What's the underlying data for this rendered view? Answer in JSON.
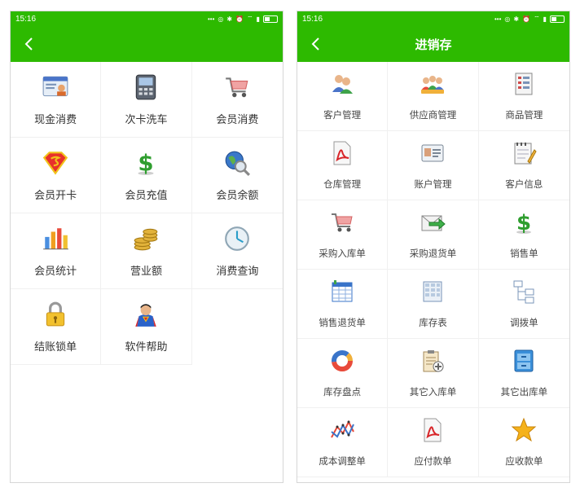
{
  "left": {
    "status": {
      "time": "15:16",
      "icons": [
        "dots-icon",
        "signal-icon",
        "bluetooth-icon",
        "alarm-icon",
        "wifi-icon",
        "cell-signal-icon",
        "battery-icon"
      ]
    },
    "title": "",
    "items": [
      {
        "label": "现金消费",
        "icon": "cash-register-icon"
      },
      {
        "label": "次卡洗车",
        "icon": "card-terminal-icon"
      },
      {
        "label": "会员消费",
        "icon": "shopping-cart-icon"
      },
      {
        "label": "会员开卡",
        "icon": "superman-shield-icon"
      },
      {
        "label": "会员充值",
        "icon": "dollar-icon"
      },
      {
        "label": "会员余额",
        "icon": "globe-search-icon"
      },
      {
        "label": "会员统计",
        "icon": "bar-chart-icon"
      },
      {
        "label": "营业额",
        "icon": "coins-icon"
      },
      {
        "label": "消费查询",
        "icon": "clock-icon"
      },
      {
        "label": "结账锁单",
        "icon": "lock-icon"
      },
      {
        "label": "软件帮助",
        "icon": "superman-icon"
      }
    ]
  },
  "right": {
    "status": {
      "time": "15:16",
      "icons": [
        "dots-icon",
        "signal-icon",
        "bluetooth-icon",
        "alarm-icon",
        "wifi-icon",
        "cell-signal-icon",
        "battery-icon"
      ]
    },
    "title": "进销存",
    "items": [
      {
        "label": "客户管理",
        "icon": "customers-icon"
      },
      {
        "label": "供应商管理",
        "icon": "suppliers-icon"
      },
      {
        "label": "商品管理",
        "icon": "product-list-icon"
      },
      {
        "label": "仓库管理",
        "icon": "pdf-document-icon"
      },
      {
        "label": "账户管理",
        "icon": "id-card-icon"
      },
      {
        "label": "客户信息",
        "icon": "notebook-pen-icon"
      },
      {
        "label": "采购入库单",
        "icon": "shopping-cart-icon"
      },
      {
        "label": "采购退货单",
        "icon": "envelope-arrow-icon"
      },
      {
        "label": "销售单",
        "icon": "dollar-icon"
      },
      {
        "label": "销售退货单",
        "icon": "spreadsheet-icon"
      },
      {
        "label": "库存表",
        "icon": "table-icon"
      },
      {
        "label": "调拨单",
        "icon": "tree-diagram-icon"
      },
      {
        "label": "库存盘点",
        "icon": "donut-chart-icon"
      },
      {
        "label": "其它入库单",
        "icon": "clipboard-add-icon"
      },
      {
        "label": "其它出库单",
        "icon": "cabinet-icon"
      },
      {
        "label": "成本调整单",
        "icon": "line-chart-icon"
      },
      {
        "label": "应付款单",
        "icon": "pdf-document-icon"
      },
      {
        "label": "应收款单",
        "icon": "star-icon"
      }
    ]
  },
  "colors": {
    "brand": "#2dba00",
    "text": "#333333",
    "divider": "#f0f0f0"
  }
}
